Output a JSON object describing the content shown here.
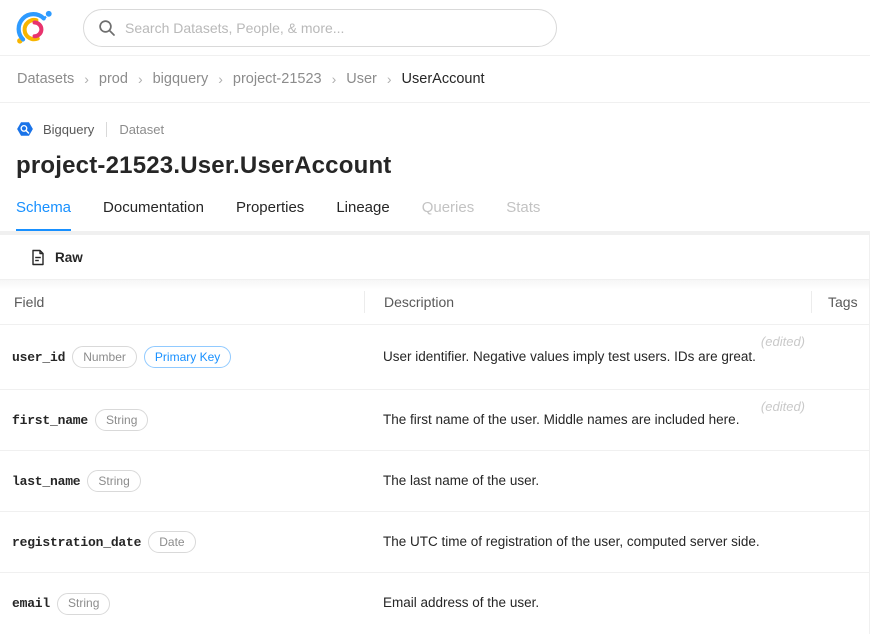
{
  "accent_color": "#1890ff",
  "topbar": {
    "search": {
      "placeholder": "Search Datasets, People, & more..."
    }
  },
  "breadcrumb": {
    "separator": "›",
    "items": [
      "Datasets",
      "prod",
      "bigquery",
      "project-21523",
      "User",
      "UserAccount"
    ]
  },
  "entity": {
    "platform": "Bigquery",
    "type": "Dataset",
    "title": "project-21523.User.UserAccount"
  },
  "tabs": [
    {
      "label": "Schema",
      "state": "active"
    },
    {
      "label": "Documentation",
      "state": "normal"
    },
    {
      "label": "Properties",
      "state": "normal"
    },
    {
      "label": "Lineage",
      "state": "normal"
    },
    {
      "label": "Queries",
      "state": "disabled"
    },
    {
      "label": "Stats",
      "state": "disabled"
    }
  ],
  "toolbar": {
    "raw_label": "Raw"
  },
  "schema_table": {
    "columns": [
      "Field",
      "Description",
      "Tags"
    ],
    "rows": [
      {
        "field": "user_id",
        "badges": [
          {
            "label": "Number",
            "style": "default"
          },
          {
            "label": "Primary Key",
            "style": "blue"
          }
        ],
        "description": "User identifier. Negative values imply test users. IDs are great.",
        "edited": "(edited)"
      },
      {
        "field": "first_name",
        "badges": [
          {
            "label": "String",
            "style": "default"
          }
        ],
        "description": "The first name of the user. Middle names are included here.",
        "edited": "(edited)"
      },
      {
        "field": "last_name",
        "badges": [
          {
            "label": "String",
            "style": "default"
          }
        ],
        "description": "The last name of the user.",
        "edited": ""
      },
      {
        "field": "registration_date",
        "badges": [
          {
            "label": "Date",
            "style": "default"
          }
        ],
        "description": "The UTC time of registration of the user, computed server side.",
        "edited": ""
      },
      {
        "field": "email",
        "badges": [
          {
            "label": "String",
            "style": "default"
          }
        ],
        "description": "Email address of the user.",
        "edited": ""
      }
    ]
  }
}
